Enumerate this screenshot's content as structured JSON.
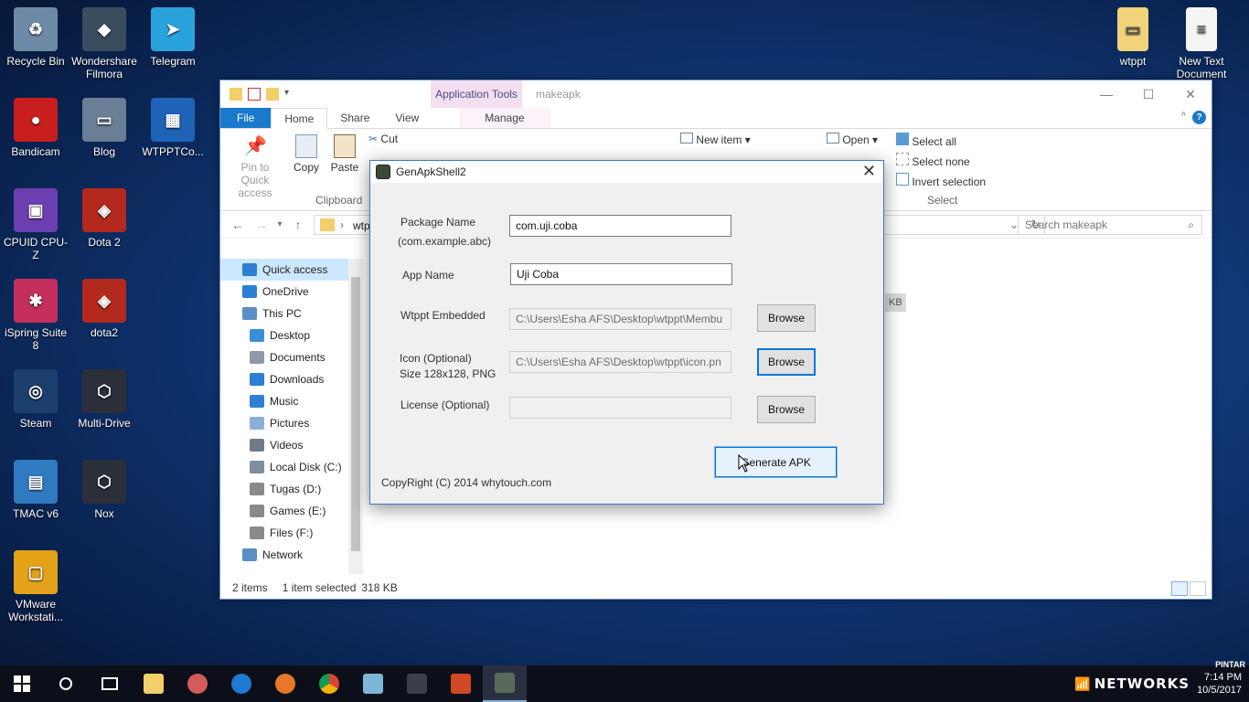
{
  "desktop": {
    "left_icons": [
      {
        "label": "Recycle Bin",
        "name": "recycle-bin",
        "color": "#6d8aa6",
        "glyph": "♻"
      },
      {
        "label": "Wondershare Filmora",
        "name": "filmora",
        "color": "#3a4d5e",
        "glyph": "◆"
      },
      {
        "label": "Telegram",
        "name": "telegram",
        "color": "#2aa3dc",
        "glyph": "➤"
      },
      {
        "label": "Bandicam",
        "name": "bandicam",
        "color": "#c81e1e",
        "glyph": "●"
      },
      {
        "label": "Blog",
        "name": "blog",
        "color": "#6a7f95",
        "glyph": "▭"
      },
      {
        "label": "WTPPTCo...",
        "name": "wtpptco",
        "color": "#1f63b9",
        "glyph": "▦"
      },
      {
        "label": "CPUID CPU-Z",
        "name": "cpuz",
        "color": "#6b3fb0",
        "glyph": "▣"
      },
      {
        "label": "Dota 2",
        "name": "dota2",
        "color": "#b3291d",
        "glyph": "◈"
      },
      {
        "label": "iSpring Suite 8",
        "name": "ispring",
        "color": "#c42f5e",
        "glyph": "✱"
      },
      {
        "label": "dota2",
        "name": "dota2-2",
        "color": "#b3291d",
        "glyph": "◈"
      },
      {
        "label": "Steam",
        "name": "steam",
        "color": "#1c3f6e",
        "glyph": "◎"
      },
      {
        "label": "Multi-Drive",
        "name": "multi-drive",
        "color": "#2b2f3a",
        "glyph": "⬡"
      },
      {
        "label": "TMAC v6",
        "name": "tmac",
        "color": "#2f7ac0",
        "glyph": "▤"
      },
      {
        "label": "Nox",
        "name": "nox",
        "color": "#2b2f3a",
        "glyph": "⬡"
      },
      {
        "label": "VMware Workstati...",
        "name": "vmware",
        "color": "#e3a21a",
        "glyph": "▢"
      }
    ],
    "right_icons": [
      {
        "label": "wtppt",
        "name": "folder-wtppt",
        "color": "#f1d37a",
        "glyph": "▭"
      },
      {
        "label": "New Text Document",
        "name": "new-text-document",
        "color": "#f5f5f5",
        "glyph": "≡"
      }
    ]
  },
  "explorer": {
    "app_tools": "Application Tools",
    "title": "makeapk",
    "tabs": {
      "file": "File",
      "home": "Home",
      "share": "Share",
      "view": "View",
      "manage": "Manage"
    },
    "ribbon": {
      "pin": "Pin to Quick access",
      "copy": "Copy",
      "paste": "Paste",
      "cut": "Cut",
      "clipboard": "Clipboard",
      "new_item": "New item",
      "open": "Open",
      "select_all": "Select all",
      "select_none": "Select none",
      "invert_selection": "Invert selection",
      "select_group": "Select"
    },
    "address_partial": "wtp",
    "search_placeholder": "Search makeapk",
    "nav": [
      {
        "label": "Quick access",
        "name": "quick-access",
        "color": "#2d7fd3",
        "sel": true,
        "indent": 24
      },
      {
        "label": "OneDrive",
        "name": "onedrive",
        "color": "#2d7fd3",
        "sel": false,
        "indent": 24
      },
      {
        "label": "This PC",
        "name": "this-pc",
        "color": "#5a8fc7",
        "sel": false,
        "indent": 24
      },
      {
        "label": "Desktop",
        "name": "desktop",
        "color": "#3b8ed8",
        "sel": false,
        "indent": 32
      },
      {
        "label": "Documents",
        "name": "documents",
        "color": "#8e9aa8",
        "sel": false,
        "indent": 32
      },
      {
        "label": "Downloads",
        "name": "downloads",
        "color": "#2d7fd3",
        "sel": false,
        "indent": 32
      },
      {
        "label": "Music",
        "name": "music",
        "color": "#2d7fd3",
        "sel": false,
        "indent": 32
      },
      {
        "label": "Pictures",
        "name": "pictures",
        "color": "#8ab0d8",
        "sel": false,
        "indent": 32
      },
      {
        "label": "Videos",
        "name": "videos",
        "color": "#6f7b89",
        "sel": false,
        "indent": 32
      },
      {
        "label": "Local Disk (C:)",
        "name": "local-disk-c",
        "color": "#7c8e9f",
        "sel": false,
        "indent": 32
      },
      {
        "label": "Tugas (D:)",
        "name": "tugas-d",
        "color": "#8a8a8a",
        "sel": false,
        "indent": 32
      },
      {
        "label": "Games (E:)",
        "name": "games-e",
        "color": "#8a8a8a",
        "sel": false,
        "indent": 32
      },
      {
        "label": "Files (F:)",
        "name": "files-f",
        "color": "#8a8a8a",
        "sel": false,
        "indent": 32
      },
      {
        "label": "Network",
        "name": "network",
        "color": "#5a8fc7",
        "sel": false,
        "indent": 24
      }
    ],
    "size_chip": "KB",
    "status": {
      "items": "2 items",
      "selected": "1 item selected",
      "size": "318 KB"
    }
  },
  "dialog": {
    "title": "GenApkShell2",
    "package_label": "Package Name",
    "package_hint": "(com.example.abc)",
    "package_value": "com.uji.coba",
    "app_label": "App Name",
    "app_value": "Uji Coba",
    "embedded_label": "Wtppt Embedded",
    "embedded_value": "C:\\Users\\Esha AFS\\Desktop\\wtppt\\Membu",
    "icon_label": "Icon (Optional)",
    "icon_hint": "Size 128x128, PNG",
    "icon_value": "C:\\Users\\Esha AFS\\Desktop\\wtppt\\icon.pn",
    "license_label": "License (Optional)",
    "license_value": "",
    "browse": "Browse",
    "generate": "Generate APK",
    "copyright": "CopyRight (C) 2014 whytouch.com"
  },
  "taskbar": {
    "time": "7:14 PM",
    "date": "10/5/2017",
    "watermark": "NETWORKS",
    "corner_text": "PINTAR"
  }
}
